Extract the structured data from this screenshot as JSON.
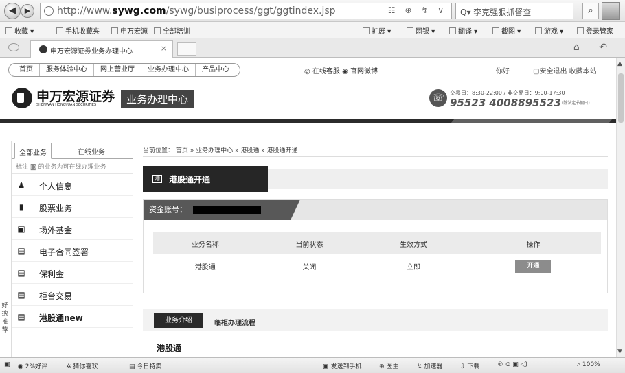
{
  "browser": {
    "url_prefix": "http://www.",
    "url_domain": "sywg.com",
    "url_path": "/sywg/busiprocess/ggt/ggtindex.jsp",
    "url_tools": "☷ ⊕ ↯ ∨",
    "search_text": "Q▾ 李克强狠抓督查",
    "favorites": [
      "收藏",
      "手机收藏夹",
      "申万宏源",
      "全部培训",
      "扩展",
      "网银",
      "翻译",
      "截图",
      "游戏",
      "登录管家"
    ],
    "tab_title": "申万宏源证券业务办理中心",
    "tab_close": "×",
    "right_tools": "⌂ ↶"
  },
  "site": {
    "topnav": [
      "首页",
      "服务体验中心",
      "网上营业厅",
      "业务办理中心",
      "产品中心"
    ],
    "service_links": "◎ 在线客服 ◉ 官网微博",
    "greeting": "你好",
    "logout": "▢安全退出 收藏本站",
    "logo_cn": "申万宏源证券",
    "logo_en": "SHENWAN HONGYUAN SECURITIES",
    "center_badge": "业务办理中心",
    "trade_hours": "交易日：8:30-22:00 / 非交易日：9:00-17:30",
    "hotline": "95523  4008895523",
    "holiday_note": "(除法定节假日)"
  },
  "sidebar": {
    "tabs": [
      "全部业务",
      "在线业务"
    ],
    "note": "标注 ◙ 的业务为可在线办理业务",
    "items": [
      {
        "label": "个人信息",
        "icon": "♟"
      },
      {
        "label": "股票业务",
        "icon": "▮"
      },
      {
        "label": "场外基金",
        "icon": "▣"
      },
      {
        "label": "电子合同签署",
        "icon": "▤"
      },
      {
        "label": "保利金",
        "icon": "▤"
      },
      {
        "label": "柜台交易",
        "icon": "▤"
      },
      {
        "label": "港股通new",
        "icon": "▤"
      }
    ],
    "float_tag": "好搜推荐"
  },
  "main": {
    "breadcrumb": "当前位置： 首页 » 业务办理中心 » 港股通 » 港股通开通",
    "title": "港股通开通",
    "account_label": "资金账号：",
    "table": {
      "headers": [
        "业务名称",
        "当前状态",
        "生效方式",
        "操作"
      ],
      "rows": [
        {
          "name": "港股通",
          "status": "关闭",
          "effect": "立即",
          "action": "开通"
        }
      ]
    },
    "intro_tabs": [
      "业务介绍",
      "临柜办理流程"
    ],
    "intro_title": "港股通"
  },
  "statusbar": {
    "left": [
      "2%好评",
      "猜你喜欢",
      "今日特卖"
    ],
    "right": [
      "发送到手机",
      "医生",
      "加速器",
      "下载"
    ],
    "zoom": "100%"
  }
}
